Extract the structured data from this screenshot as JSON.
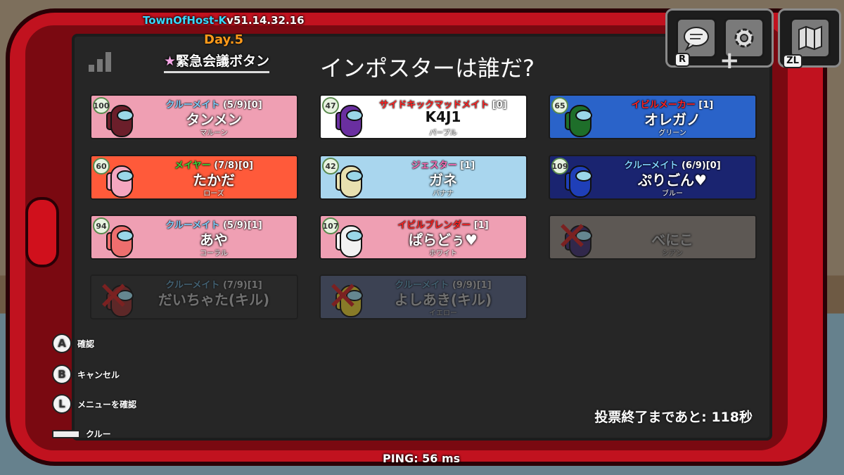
{
  "header": {
    "mod_name": "TownOfHost-K",
    "version": "v51.14.32.16",
    "day": "Day.5",
    "meeting_star": "★",
    "meeting_label": "緊急会議ボタン",
    "title": "インポスターは誰だ?"
  },
  "top_right": {
    "chat_key": "R",
    "map_key": "ZL"
  },
  "players": [
    {
      "level": "100",
      "role": "クルーメイト",
      "tasks": "(5/9)",
      "votes": "[0]",
      "name": "タンメン",
      "color_name": "マルーン",
      "role_color": "#7fd0ff",
      "bg": "#ef9fb3",
      "dead": false
    },
    {
      "level": "47",
      "role": "サイドキックマッドメイト",
      "tasks": "",
      "votes": "[0]",
      "name": "K4J1",
      "color_name": "パープル",
      "role_color": "#ff2222",
      "bg": "#ffffff",
      "dead": false
    },
    {
      "level": "65",
      "role": "イビルメーカー",
      "tasks": "",
      "votes": "[1]",
      "name": "オレガノ",
      "color_name": "グリーン",
      "role_color": "#ff2222",
      "bg": "#2a63c9",
      "dead": false
    },
    {
      "level": "60",
      "role": "メイヤー",
      "tasks": "(7/8)",
      "votes": "[0]",
      "name": "たかだ",
      "color_name": "ローズ",
      "role_color": "#3ad23a",
      "bg": "#ff5a3a",
      "dead": false
    },
    {
      "level": "42",
      "role": "ジェスター",
      "tasks": "",
      "votes": "[1]",
      "name": "ガネ",
      "color_name": "バナナ",
      "role_color": "#ff6fb8",
      "bg": "#a9d6ee",
      "dead": false
    },
    {
      "level": "109",
      "role": "クルーメイト",
      "tasks": "(6/9)",
      "votes": "[0]",
      "name": "ぷりごん♥",
      "color_name": "ブルー",
      "role_color": "#7fd0ff",
      "bg": "#1a2470",
      "dead": false
    },
    {
      "level": "94",
      "role": "クルーメイト",
      "tasks": "(5/9)",
      "votes": "[1]",
      "name": "あや",
      "color_name": "コーラル",
      "role_color": "#7fd0ff",
      "bg": "#ef9fb3",
      "dead": false
    },
    {
      "level": "107",
      "role": "イビルブレンダー",
      "tasks": "",
      "votes": "[1]",
      "name": "ぱらどぅ♥",
      "color_name": "ホワイト",
      "role_color": "#ff2222",
      "bg": "#ef9fb3",
      "dead": false
    },
    {
      "level": "",
      "role": "",
      "tasks": "",
      "votes": "",
      "name": "べにこ",
      "color_name": "シアン",
      "role_color": "#7fd0ff",
      "bg": "#c9bcb1",
      "dead": true
    },
    {
      "level": "",
      "role": "クルーメイト",
      "tasks": "(7/9)",
      "votes": "[1]",
      "name": "だいちゃた(キル)",
      "color_name": "",
      "role_color": "#7fd0ff",
      "bg": "#3a3a3a",
      "dead": true
    },
    {
      "level": "",
      "role": "クルーメイト",
      "tasks": "(9/9)",
      "votes": "[1]",
      "name": "よしあき(キル)",
      "color_name": "イエロー",
      "role_color": "#7fd0ff",
      "bg": "#6d7fb0",
      "dead": true
    }
  ],
  "legend": [
    {
      "key": "A",
      "label": "確認"
    },
    {
      "key": "B",
      "label": "キャンセル"
    },
    {
      "key": "L",
      "label": "メニューを確認"
    },
    {
      "key": "",
      "label": "クルー"
    }
  ],
  "timer": "投票終了まであと: 118秒",
  "ping": "PING: 56 ms",
  "colors": {
    "tablet": "#c1121f",
    "screen": "#262626",
    "version_name": "#38d9ff",
    "day": "#ff9a1a"
  }
}
